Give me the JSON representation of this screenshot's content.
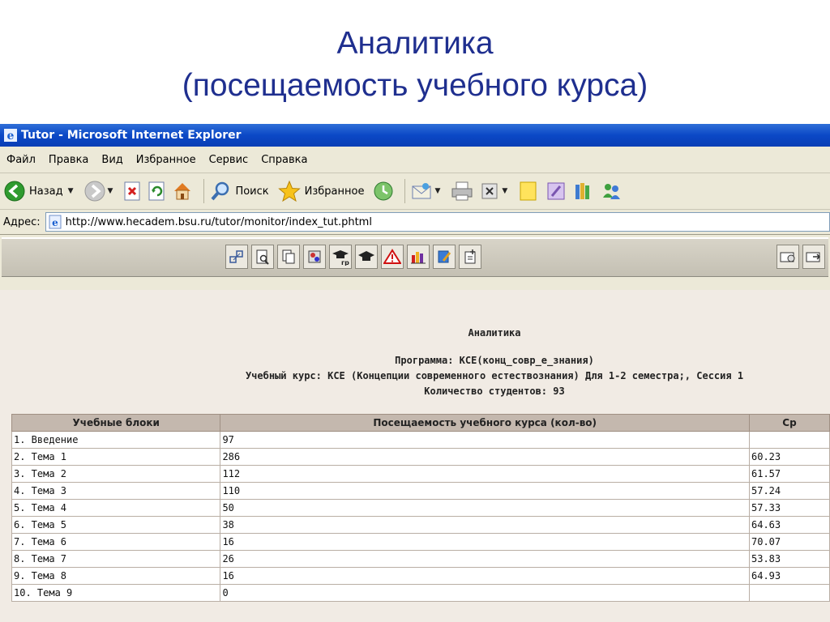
{
  "slide": {
    "title_line1": "Аналитика",
    "title_line2": "(посещаемость учебного курса)"
  },
  "window": {
    "title": "Tutor - Microsoft Internet Explorer",
    "menu": [
      "Файл",
      "Правка",
      "Вид",
      "Избранное",
      "Сервис",
      "Справка"
    ],
    "toolbar": {
      "back_label": "Назад",
      "search_label": "Поиск",
      "favorites_label": "Избранное"
    },
    "address": {
      "label": "Адрес:",
      "url": "http://www.hecadem.bsu.ru/tutor/monitor/index_tut.phtml"
    }
  },
  "report": {
    "heading": "Аналитика",
    "program": "Программа: КСЕ(конц_совр_е_знания)",
    "course": "Учебный курс: КСЕ (Концепции современного естествознания) Для 1-2 семестра;, Сессия 1",
    "students": "Количество студентов: 93",
    "columns": [
      "Учебные блоки",
      "Посещаемость учебного курса (кол-во)",
      "Ср"
    ],
    "rows": [
      {
        "block": "1. Введение",
        "visits": "97",
        "avg": ""
      },
      {
        "block": "2. Тема 1",
        "visits": "286",
        "avg": "60.23"
      },
      {
        "block": "3. Тема 2",
        "visits": "112",
        "avg": "61.57"
      },
      {
        "block": "4. Тема 3",
        "visits": "110",
        "avg": "57.24"
      },
      {
        "block": "5. Тема 4",
        "visits": "50",
        "avg": "57.33"
      },
      {
        "block": "6. Тема 5",
        "visits": "38",
        "avg": "64.63"
      },
      {
        "block": "7. Тема 6",
        "visits": "16",
        "avg": "70.07"
      },
      {
        "block": "8. Тема 7",
        "visits": "26",
        "avg": "53.83"
      },
      {
        "block": "9. Тема 8",
        "visits": "16",
        "avg": "64.93"
      },
      {
        "block": "10. Тема 9",
        "visits": "0",
        "avg": ""
      }
    ]
  },
  "colors": {
    "slide_title": "#1f2f8f",
    "titlebar": "#0b48c6",
    "chrome": "#ece9d8",
    "table_header": "#c4b8ae",
    "content_bg": "#f1ebe4"
  }
}
